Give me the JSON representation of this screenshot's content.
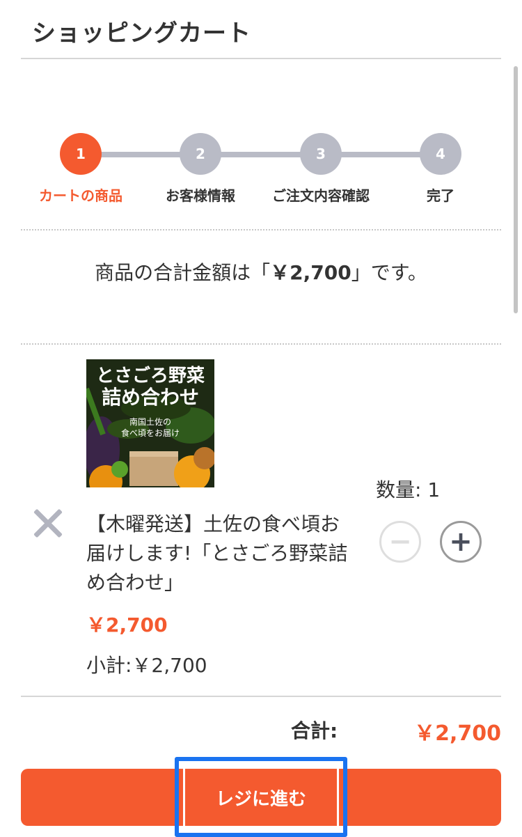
{
  "header": {
    "title": "ショッピングカート"
  },
  "steps": [
    {
      "number": "1",
      "label": "カートの商品",
      "active": true
    },
    {
      "number": "2",
      "label": "お客様情報",
      "active": false
    },
    {
      "number": "3",
      "label": "ご注文内容確認",
      "active": false
    },
    {
      "number": "4",
      "label": "完了",
      "active": false
    }
  ],
  "summary": {
    "prefix": "商品の合計金額は「",
    "amount": "￥2,700",
    "suffix": "」です。"
  },
  "item": {
    "image_text": {
      "line1": "とさごろ野菜",
      "line2": "詰め合わせ",
      "tagline1": "南国土佐の",
      "tagline2": "食べ頃をお届け"
    },
    "name": "【木曜発送】土佐の食べ頃お届けします!「とさごろ野菜詰め合わせ」",
    "price": "￥2,700",
    "subtotal": "小計:￥2,700",
    "quantity_label": "数量:",
    "quantity": "1"
  },
  "icons": {
    "remove": "close-icon",
    "decrement": "minus-icon",
    "increment": "plus-icon"
  },
  "totals": {
    "label": "合計:",
    "value": "￥2,700"
  },
  "checkout": {
    "label": "レジに進む"
  },
  "colors": {
    "accent": "#f45a2f",
    "inactive_step": "#b9bbc6",
    "focus": "#1a73f0"
  }
}
